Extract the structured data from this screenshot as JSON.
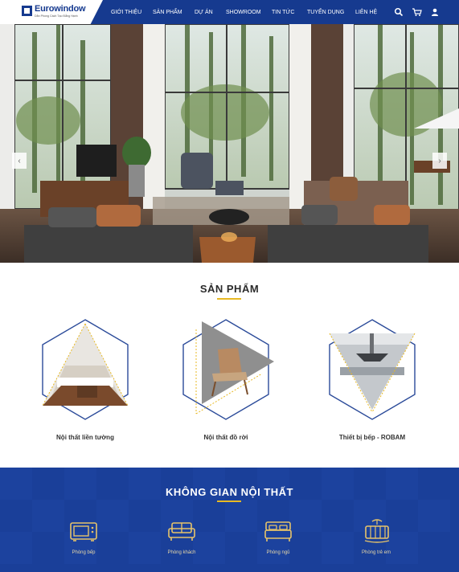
{
  "header": {
    "logo_text": "Eurowindow",
    "logo_tagline": "Dẫn Phong Cách Tạo Đẳng Hạnh",
    "nav": [
      "GIỚI THIỆU",
      "SẢN PHẨM",
      "DỰ ÁN",
      "SHOWROOM",
      "TIN TỨC",
      "TUYỂN DỤNG",
      "LIÊN HỆ"
    ],
    "icons": [
      "search-icon",
      "cart-icon",
      "user-icon"
    ]
  },
  "hero": {
    "prev_arrow": "‹",
    "next_arrow": "›"
  },
  "products": {
    "title": "SẢN PHẨM",
    "items": [
      {
        "label": "Nội thất liền tường"
      },
      {
        "label": "Nội thất đồ rời"
      },
      {
        "label": "Thiết bị bếp - ROBAM"
      }
    ]
  },
  "interior": {
    "title": "KHÔNG GIAN NỘI THẤT",
    "rooms": [
      {
        "label": "Phòng bếp",
        "icon": "microwave-icon"
      },
      {
        "label": "Phòng khách",
        "icon": "sofa-icon"
      },
      {
        "label": "Phòng ngủ",
        "icon": "bed-icon"
      },
      {
        "label": "Phòng trẻ em",
        "icon": "crib-icon"
      }
    ]
  },
  "colors": {
    "brand_blue": "#163a8f",
    "accent_gold": "#e8b923",
    "section_blue": "#1a3f99"
  }
}
